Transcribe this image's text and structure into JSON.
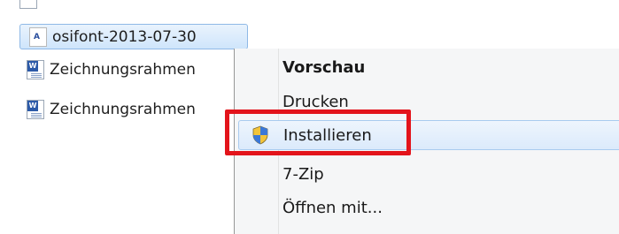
{
  "files": {
    "top_item": "",
    "selected": "osifont-2013-07-30",
    "doc1": "Zeichnungsrahmen",
    "doc2": "Zeichnungsrahmen",
    "font_icon_glyph": "A",
    "doc_icon_glyph": "W"
  },
  "context_menu": {
    "items": [
      {
        "label": "Vorschau",
        "icon": ""
      },
      {
        "label": "Drucken",
        "icon": ""
      },
      {
        "label": "Installieren",
        "icon": "uac-shield-icon"
      },
      {
        "label": "7-Zip",
        "icon": ""
      },
      {
        "label": "Öffnen mit...",
        "icon": ""
      }
    ]
  },
  "colors": {
    "highlight": "#e3141b",
    "selection": "#cfe5fb"
  }
}
